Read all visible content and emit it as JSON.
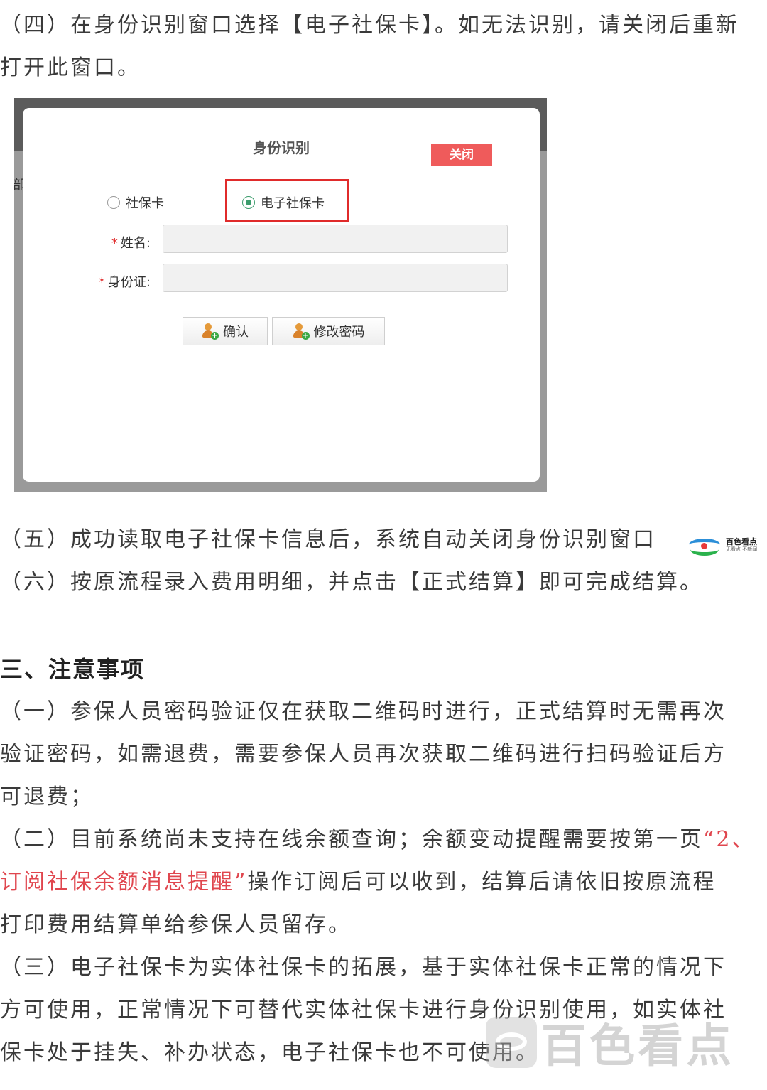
{
  "paragraphs": {
    "step4": {
      "line1": "（四）在身份识别窗口选择【电子社保卡】。如无法识别，请关闭后重新",
      "line2": "打开此窗口。"
    },
    "step5": "（五）成功读取电子社保卡信息后，系统自动关闭身份识别窗口",
    "step6": "（六）按原流程录入费用明细，并点击【正式结算】即可完成结算。"
  },
  "notes": {
    "heading": "三、注意事项",
    "note1": {
      "line1": "（一）参保人员密码验证仅在获取二维码时进行，正式结算时无需再次",
      "line2": "验证密码，如需退费，需要参保人员再次获取二维码进行扫码验证后方",
      "line3": "可退费；"
    },
    "note2": {
      "line1_a": "（二）目前系统尚未支持在线余额查询；余额变动提醒需要按第一页",
      "line1_b": "“2、",
      "line2_a": "订阅社保余额消息提醒”",
      "line2_b": "操作订阅后可以收到，结算后请依旧按原流程",
      "line3": "打印费用结算单给参保人员留存。"
    },
    "note3": {
      "line1": "（三）电子社保卡为实体社保卡的拓展，基于实体社保卡正常的情况下",
      "line2": "方可使用，正常情况下可替代实体社保卡进行身份识别使用，如实体社",
      "line3": "保卡处于挂失、补办状态，电子社保卡也不可使用。"
    }
  },
  "dialog": {
    "background_glyph": "部",
    "title": "身份识别",
    "close_label": "关闭",
    "radio_options": [
      {
        "label": "社保卡",
        "checked": false
      },
      {
        "label": "电子社保卡",
        "checked": true
      }
    ],
    "name_label": "姓名:",
    "id_label": "身份证:",
    "required_mark": "*",
    "name_value": "",
    "id_value": "",
    "confirm_label": "确认",
    "change_password_label": "修改密码"
  },
  "branding": {
    "logo_title": "百色看点",
    "logo_sub": "无看点 不新闻",
    "watermark": "百色看点"
  },
  "colors": {
    "accent_red": "#e0464e",
    "close_button": "#ef5b5b",
    "highlight_border": "#e02b2b"
  }
}
